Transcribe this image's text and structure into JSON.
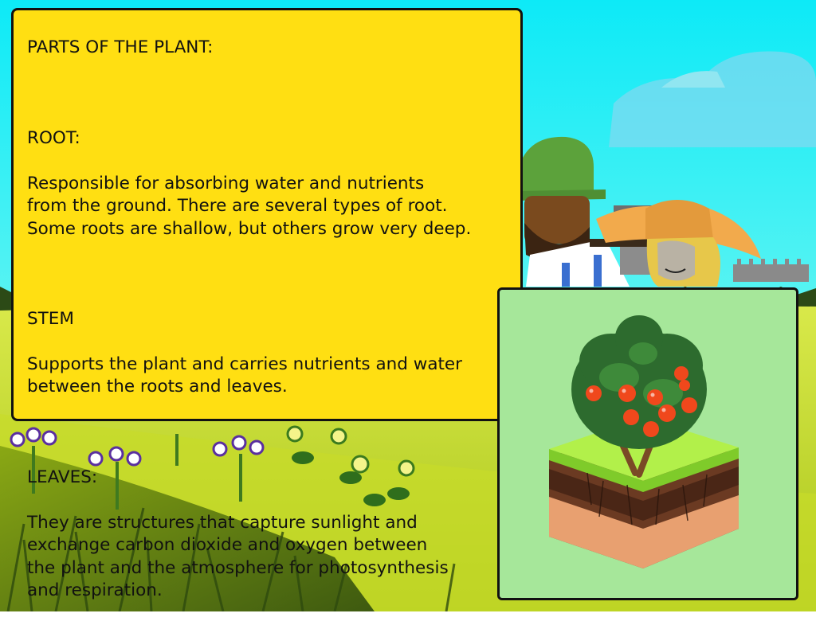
{
  "info_panel": {
    "heading": "PARTS OF THE PLANT:",
    "root_title": "ROOT:",
    "root_text": "Responsible for absorbing water and nutrients\nfrom the ground. There are several types of root.\nSome roots are shallow, but others grow very deep.",
    "stem_title": "STEM",
    "stem_text": "Supports the plant and carries nutrients and water\nbetween the roots and leaves.",
    "leaves_title": "LEAVES:",
    "leaves_text": "They are structures that capture sunlight and\nexchange carbon dioxide and oxygen between\nthe plant and the atmosphere for photosynthesis\n and respiration."
  },
  "colors": {
    "sky": "#25EEF8",
    "panel": "#FFDF12",
    "card": "#A6E79A",
    "grass": "#B7D61A",
    "tomato": "#F0481C"
  },
  "icons": {
    "farmer_man": "farmer-man-icon",
    "farmer_woman": "farmer-woman-icon",
    "tomato_plant": "tomato-plant-icon"
  }
}
